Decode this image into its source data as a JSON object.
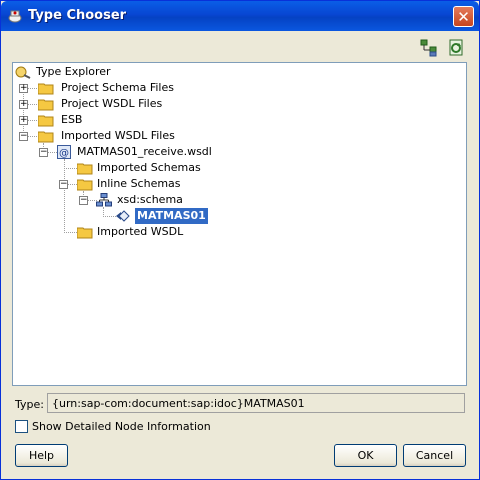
{
  "window": {
    "title": "Type Chooser",
    "close_glyph": "✕"
  },
  "toolbar": {
    "icons": [
      "expand-tree-icon",
      "refresh-icon"
    ]
  },
  "tree": {
    "root": "Type Explorer",
    "items": [
      {
        "label": "Project Schema Files",
        "expander": "+"
      },
      {
        "label": "Project WSDL Files",
        "expander": "+"
      },
      {
        "label": "ESB",
        "expander": "+"
      },
      {
        "label": "Imported WSDL Files",
        "expander": "−"
      },
      {
        "label": "MATMAS01_receive.wsdl",
        "expander": "−"
      },
      {
        "label": "Imported Schemas"
      },
      {
        "label": "Inline Schemas",
        "expander": "−"
      },
      {
        "label": "xsd:schema",
        "expander": "−"
      },
      {
        "label": "MATMAS01",
        "selected": true
      },
      {
        "label": "Imported WSDL"
      }
    ]
  },
  "type_field": {
    "label": "Type:",
    "value": "{urn:sap-com:document:sap:idoc}MATMAS01"
  },
  "checkbox": {
    "label": "Show Detailed Node Information",
    "checked": false
  },
  "buttons": {
    "help": "Help",
    "ok": "OK",
    "cancel": "Cancel"
  },
  "colors": {
    "titlebar": "#0a5ee7",
    "selection": "#316ac5",
    "folder": "#f5c842"
  }
}
